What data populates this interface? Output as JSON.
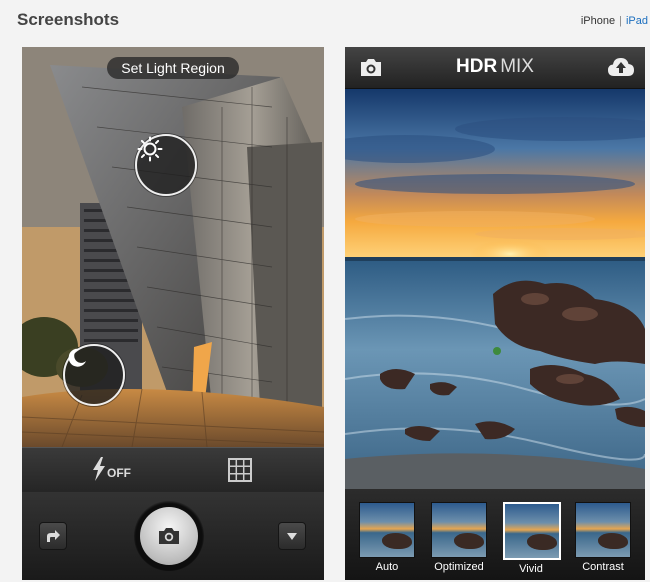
{
  "header": {
    "title": "Screenshots",
    "device_links": {
      "iphone": "iPhone",
      "ipad": "iPad"
    }
  },
  "left_screen": {
    "pill_label": "Set Light Region",
    "flash_label": "OFF",
    "icons": [
      "sun-icon",
      "moon-icon",
      "flash-icon",
      "grid-icon",
      "share-icon",
      "camera-icon",
      "dropdown-icon"
    ]
  },
  "right_screen": {
    "app_title_bold": "HDR",
    "app_title_light": "MIX",
    "icons": [
      "camera-icon",
      "cloud-upload-icon"
    ],
    "filters": [
      {
        "label": "Auto",
        "selected": false
      },
      {
        "label": "Optimized",
        "selected": false
      },
      {
        "label": "Vivid",
        "selected": true
      },
      {
        "label": "Contrast",
        "selected": false
      }
    ]
  }
}
